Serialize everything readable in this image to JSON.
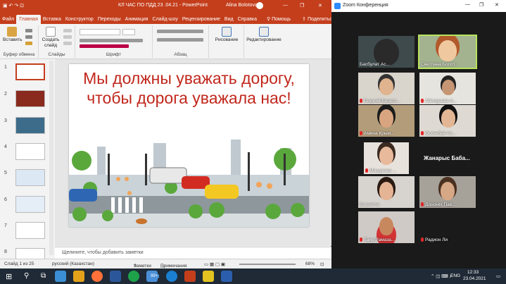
{
  "powerpoint": {
    "title": "КЛ ЧАС ПО ПДД 23 .04.21  -  PowerPoint",
    "user": "Alina Bolotova",
    "tabs": [
      "Файл",
      "Главная",
      "Вставка",
      "Конструктор",
      "Переходы",
      "Анимация",
      "Слайд-шоу",
      "Рецензирование",
      "Вид",
      "Справка",
      "Помощь",
      "Поделиться"
    ],
    "active_tab": "Главная",
    "ribbon": {
      "paste": "Вставить",
      "clipboard": "Буфер обмена",
      "new_slide": "Создать слайд",
      "slides": "Слайды",
      "font": "Шрифт",
      "paragraph": "Абзац",
      "drawing": "Рисование",
      "editing": "Редактирование"
    },
    "thumbnails": [
      "1",
      "2",
      "3",
      "4",
      "5",
      "6",
      "7",
      "8"
    ],
    "slide_title": "Мы должны уважать дорогу, чтобы дорога уважала нас!",
    "notes_placeholder": "Щелкните, чтобы добавить заметки",
    "status": {
      "slide": "Слайд 1 из 25",
      "language": "русский (Казахстан)",
      "notes": "Заметки",
      "comments": "Примечания",
      "zoom": "68%"
    }
  },
  "zoom": {
    "title": "Zoom Конференция",
    "participants": [
      {
        "name": "Басбулат Ас..."
      },
      {
        "name": "Светлана Болот..."
      },
      {
        "name": "Георгий Берест..."
      },
      {
        "name": "Абилдиева А..."
      },
      {
        "name": "Амина Крым..."
      },
      {
        "name": "Оскенбай Ах..."
      },
      {
        "name": "Мишукова ..."
      },
      {
        "name": "Жанарыс  Баба..."
      },
      {
        "name": "Виолетта"
      },
      {
        "name": "Донских Пав..."
      },
      {
        "name": "Таир Рамаза..."
      },
      {
        "name": "Радион Ли"
      }
    ]
  },
  "taskbar": {
    "badge": "99+",
    "lang": "ENG",
    "time": "12:33",
    "date": "23.04.2021"
  }
}
